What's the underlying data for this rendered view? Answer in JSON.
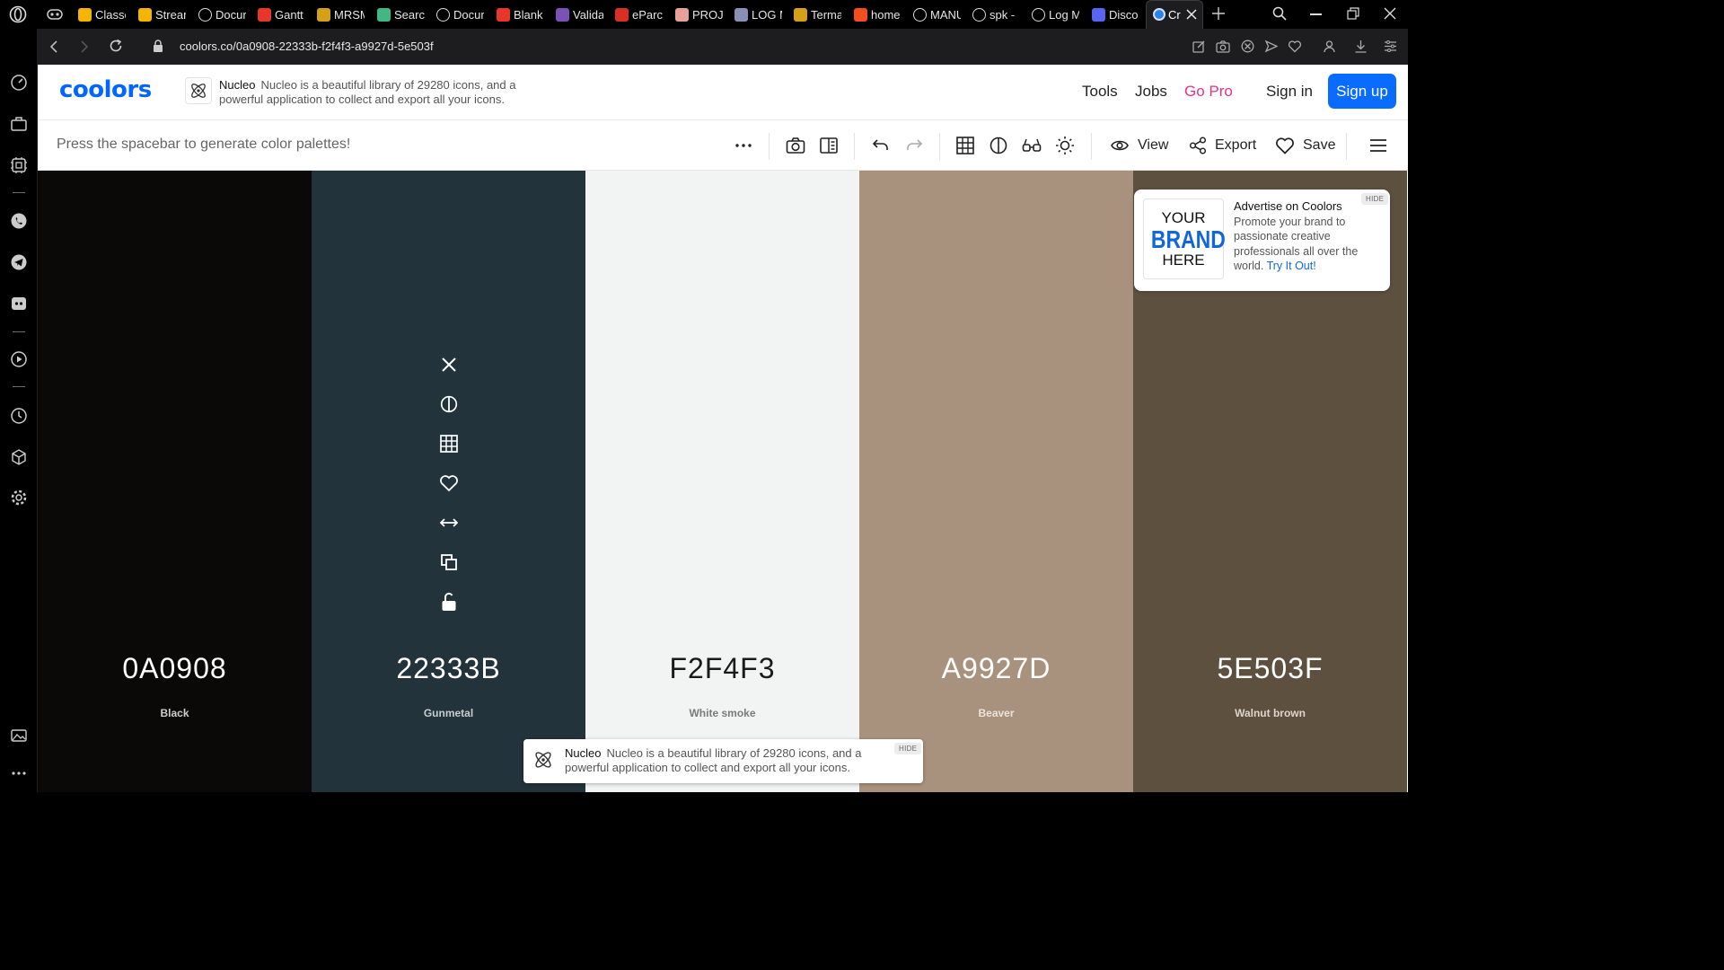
{
  "browser": {
    "tabs": [
      {
        "label": "Classe",
        "favicon": "slides-icon",
        "color": "#f4b400"
      },
      {
        "label": "Strear",
        "favicon": "slides-icon",
        "color": "#f4b400"
      },
      {
        "label": "Docur",
        "favicon": "notion-icon",
        "color": "#ffffff"
      },
      {
        "label": "Gantt",
        "favicon": "asterisk-icon",
        "color": "#e8362b"
      },
      {
        "label": "MRSM",
        "favicon": "crest-icon",
        "color": "#d4a017"
      },
      {
        "label": "Searc",
        "favicon": "vue-icon",
        "color": "#41b883"
      },
      {
        "label": "Docur",
        "favicon": "notion-icon",
        "color": "#ffffff"
      },
      {
        "label": "Blank",
        "favicon": "asterisk-icon",
        "color": "#e8362b"
      },
      {
        "label": "Valida",
        "favicon": "bootstrap-icon",
        "color": "#7952b3"
      },
      {
        "label": "eParc",
        "favicon": "eparcel-icon",
        "color": "#d93025"
      },
      {
        "label": "PROJE",
        "favicon": "project-icon",
        "color": "#e7a09a"
      },
      {
        "label": "LOG M",
        "favicon": "log-icon",
        "color": "#8a8fb5"
      },
      {
        "label": "Terma",
        "favicon": "crest-icon",
        "color": "#d4a017"
      },
      {
        "label": "home",
        "favicon": "figma-icon",
        "color": "#f24e1e"
      },
      {
        "label": "MANU",
        "favicon": "globe-icon",
        "color": "#ffffff"
      },
      {
        "label": "spk -",
        "favicon": "google-icon",
        "color": "#ffffff"
      },
      {
        "label": "Log M",
        "favicon": "globe-icon",
        "color": "#ffffff"
      },
      {
        "label": "Disco",
        "favicon": "discord-icon",
        "color": "#5865f2"
      }
    ],
    "active_tab": {
      "label": "Cr",
      "favicon": "coolors-icon"
    },
    "url": "coolors.co/0a0908-22333b-f2f4f3-a9927d-5e503f"
  },
  "header": {
    "logo": "coolors",
    "ad": {
      "brand": "Nucleo",
      "text_line1": "Nucleo is a beautiful library of 29280 icons, and a",
      "text_line2": "powerful application to collect and export all your icons."
    },
    "nav": {
      "tools": "Tools",
      "jobs": "Jobs",
      "gopro": "Go Pro",
      "signin": "Sign in",
      "signup": "Sign up"
    },
    "colors": {
      "accent": "#0a6cff",
      "gopro": "#e8318b"
    }
  },
  "toolbar": {
    "hint": "Press the spacebar to generate color palettes!",
    "view": "View",
    "export": "Export",
    "save": "Save"
  },
  "palette": [
    {
      "hex": "0A0908",
      "name": "Black",
      "color": "#0a0908",
      "text_color": "#ffffff",
      "name_color": "#cfcfcf"
    },
    {
      "hex": "22333B",
      "name": "Gunmetal",
      "color": "#22333b",
      "text_color": "#ffffff",
      "name_color": "#c7cdd0"
    },
    {
      "hex": "F2F4F3",
      "name": "White smoke",
      "color": "#f2f4f3",
      "text_color": "#1a1a1a",
      "name_color": "#7a7a7a"
    },
    {
      "hex": "A9927D",
      "name": "Beaver",
      "color": "#a9927d",
      "text_color": "#ffffff",
      "name_color": "#ece3da"
    },
    {
      "hex": "5E503F",
      "name": "Walnut brown",
      "color": "#5e503f",
      "text_color": "#ffffff",
      "name_color": "#ddd6cd"
    }
  ],
  "side_ad": {
    "brand_line1": "YOUR",
    "brand_line2": "BRAND",
    "brand_line3": "HERE",
    "title": "Advertise on Coolors",
    "body": "Promote your brand to passionate creative professionals all over the world.",
    "link": "Try It Out!",
    "hide": "HIDE"
  },
  "bottom_ad": {
    "brand": "Nucleo",
    "text_line1": "Nucleo is a beautiful library of 29280 icons, and a",
    "text_line2": "powerful application to collect and export all your icons.",
    "hide": "HIDE"
  }
}
